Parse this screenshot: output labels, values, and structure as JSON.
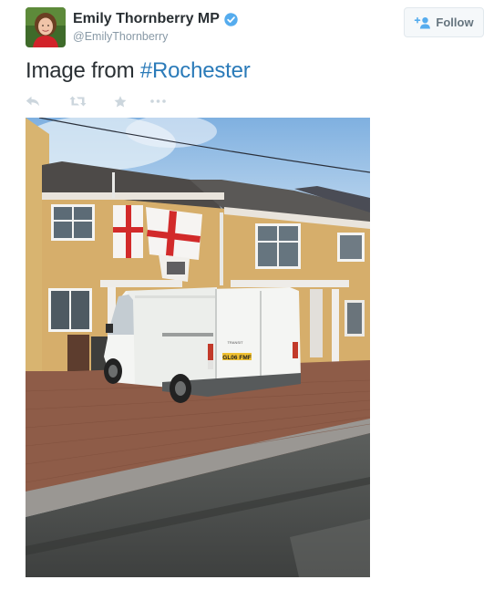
{
  "author": {
    "display_name": "Emily Thornberry MP",
    "handle": "@EmilyThornberry",
    "verified": true
  },
  "follow_button": {
    "label": "Follow",
    "icon": "person-plus-icon"
  },
  "tweet": {
    "text_prefix": "Image from ",
    "hashtag": "#Rochester",
    "media_icon_names": [
      "house-photo"
    ]
  },
  "actions": [
    {
      "name": "reply",
      "icon": "reply-arrow-icon"
    },
    {
      "name": "retweet",
      "icon": "retweet-icon"
    },
    {
      "name": "favorite",
      "icon": "star-icon"
    },
    {
      "name": "more",
      "icon": "ellipsis-icon"
    }
  ],
  "media": {
    "van_plate": "GL06 FMF",
    "van_badge": "TRANSIT"
  },
  "colors": {
    "hashtag": "#2b7bb9",
    "verified": "#55acee",
    "secondary_text": "#8899a6",
    "icon_gray": "#ccd6dd"
  }
}
